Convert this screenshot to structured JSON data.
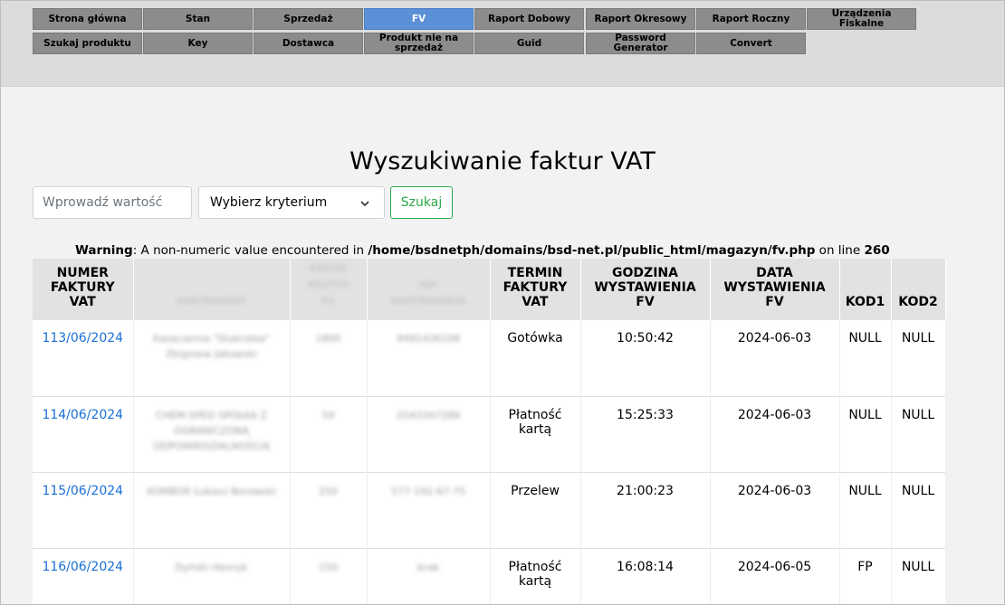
{
  "nav": {
    "row1": [
      {
        "label": "Strona główna",
        "active": false
      },
      {
        "label": "Stan",
        "active": false
      },
      {
        "label": "Sprzedaż",
        "active": false
      },
      {
        "label": "FV",
        "active": true
      },
      {
        "label": "Raport Dobowy",
        "active": false
      },
      {
        "label": "Raport Okresowy",
        "active": false
      },
      {
        "label": "Raport Roczny",
        "active": false
      },
      {
        "label": "Urządzenia\nFiskalne",
        "active": false
      }
    ],
    "row2": [
      {
        "label": "Szukaj produktu",
        "active": false
      },
      {
        "label": "Key",
        "active": false
      },
      {
        "label": "Dostawca",
        "active": false
      },
      {
        "label": "Produkt nie na\nsprzedaż",
        "active": false
      },
      {
        "label": "Guid",
        "active": false
      },
      {
        "label": "Password\nGenerator",
        "active": false
      },
      {
        "label": "Convert",
        "active": false
      }
    ]
  },
  "page": {
    "title": "Wyszukiwanie faktur VAT"
  },
  "search": {
    "placeholder": "Wprowadź wartość",
    "criterion": "Wybierz kryterium",
    "button": "Szukaj"
  },
  "warning": {
    "prefix": "Warning",
    "text": ": A non-numeric value encountered in ",
    "path": "/home/bsdnetph/domains/bsd-net.pl/public_html/magazyn/fv.php",
    "on_line": " on line ",
    "line": "260"
  },
  "table": {
    "headers": [
      "NUMER\nFAKTURY\nVAT",
      "KONTRAHENT",
      "KWOTA\nBRUTTO\nFV",
      "NIP\nKONTRAHENTA",
      "TERMIN\nFAKTURY\nVAT",
      "GODZINA\nWYSTAWIENIA\nFV",
      "DATA\nWYSTAWIENIA\nFV",
      "KOD1",
      "KOD2"
    ],
    "rows": [
      [
        "113/06/2024",
        "Kwiaciarnia \"Stokrotka\" Zbigniew Jakowski",
        "1800",
        "9491426108",
        "Gotówka",
        "10:50:42",
        "2024-06-03",
        "NULL",
        "NULL"
      ],
      [
        "114/06/2024",
        "CHEM-SPED SPÓŁKA Z OGRANICZONĄ ODPOWIEDZIALNOŚCIĄ",
        "59",
        "2543347289",
        "Płatność\nkartą",
        "15:25:33",
        "2024-06-03",
        "NULL",
        "NULL"
      ],
      [
        "115/06/2024",
        "KOMBOR Łukasz Borowski",
        "250",
        "577-192-67-75",
        "Przelew",
        "21:00:23",
        "2024-06-03",
        "NULL",
        "NULL"
      ],
      [
        "116/06/2024",
        "Dyński Henryk",
        "150",
        "brak",
        "Płatność\nkartą",
        "16:08:14",
        "2024-06-05",
        "FP",
        "NULL"
      ]
    ]
  }
}
